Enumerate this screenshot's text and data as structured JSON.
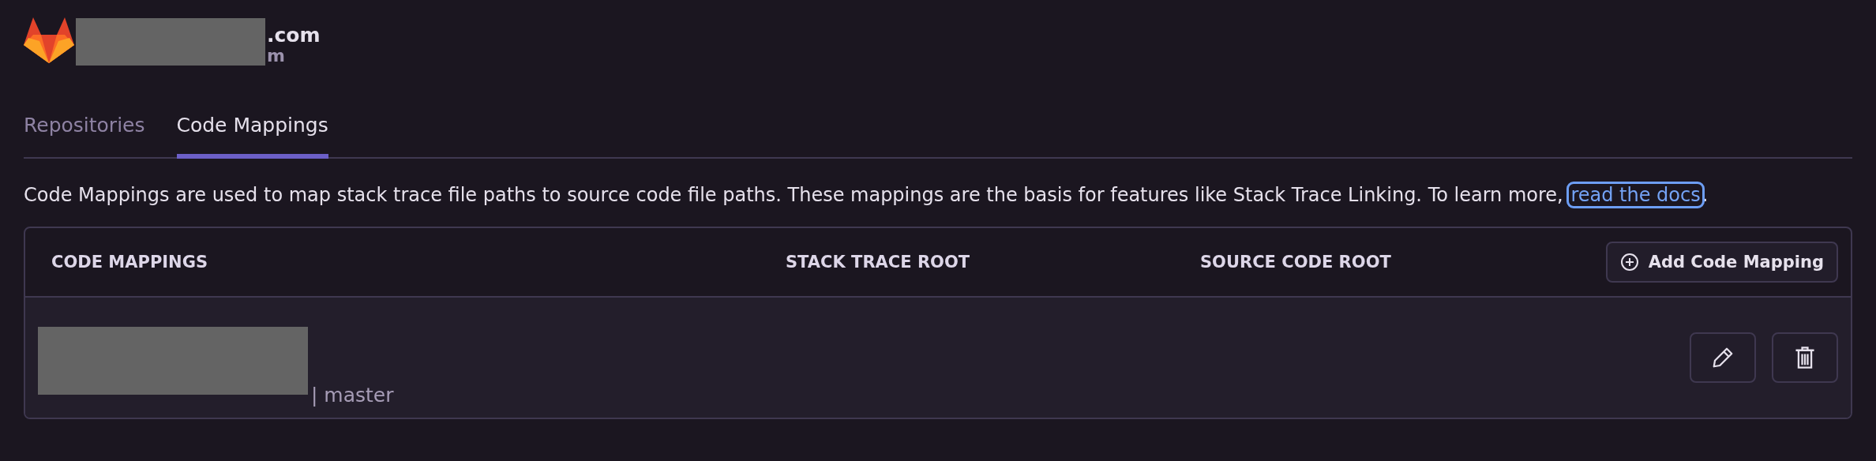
{
  "integration": {
    "name": ".com",
    "subtitle": "m"
  },
  "tabs": [
    {
      "label": "Repositories",
      "selected": false
    },
    {
      "label": "Code Mappings",
      "selected": true
    }
  ],
  "description": {
    "text": "Code Mappings are used to map stack trace file paths to source code file paths. These mappings are the basis for features like Stack Trace Linking. To learn more,",
    "link": "read the docs",
    "after": "."
  },
  "table": {
    "columns": [
      "CODE MAPPINGS",
      "STACK TRACE ROOT",
      "SOURCE CODE ROOT"
    ],
    "add_button": "Add Code Mapping",
    "rows": [
      {
        "separator": "|",
        "branch": "master"
      }
    ]
  }
}
